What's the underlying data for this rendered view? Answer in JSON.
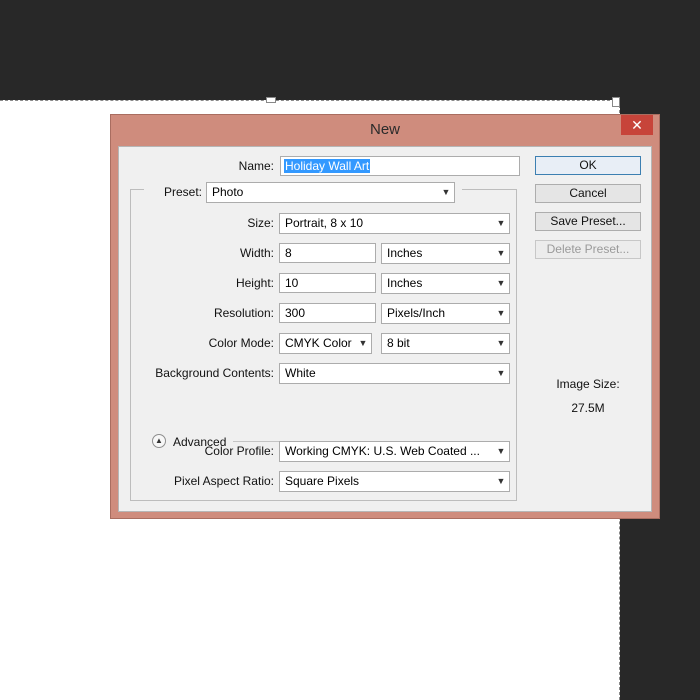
{
  "dialog": {
    "title": "New",
    "close_glyph": "✕"
  },
  "form": {
    "name_label": "Name:",
    "name_value": "Holiday Wall Art",
    "preset_label": "Preset:",
    "preset_value": "Photo",
    "size_label": "Size:",
    "size_value": "Portrait, 8 x 10",
    "width_label": "Width:",
    "width_value": "8",
    "width_unit": "Inches",
    "height_label": "Height:",
    "height_value": "10",
    "height_unit": "Inches",
    "resolution_label": "Resolution:",
    "resolution_value": "300",
    "resolution_unit": "Pixels/Inch",
    "color_mode_label": "Color Mode:",
    "color_mode_value": "CMYK Color",
    "bit_depth_value": "8 bit",
    "background_label": "Background Contents:",
    "background_value": "White",
    "advanced_label": "Advanced",
    "color_profile_label": "Color Profile:",
    "color_profile_value": "Working CMYK:  U.S. Web Coated ...",
    "pixel_aspect_label": "Pixel Aspect Ratio:",
    "pixel_aspect_value": "Square Pixels"
  },
  "buttons": {
    "ok": "OK",
    "cancel": "Cancel",
    "save_preset": "Save Preset...",
    "delete_preset": "Delete Preset..."
  },
  "image_size": {
    "label": "Image Size:",
    "value": "27.5M"
  },
  "icons": {
    "dropdown": "chevron-down-icon",
    "advanced": "collapse-up-icon",
    "close": "close-icon"
  },
  "colors": {
    "dialog_frame": "#cf8c7d",
    "close_button": "#c7443a",
    "selection": "#3399ff",
    "workspace": "#282828"
  }
}
